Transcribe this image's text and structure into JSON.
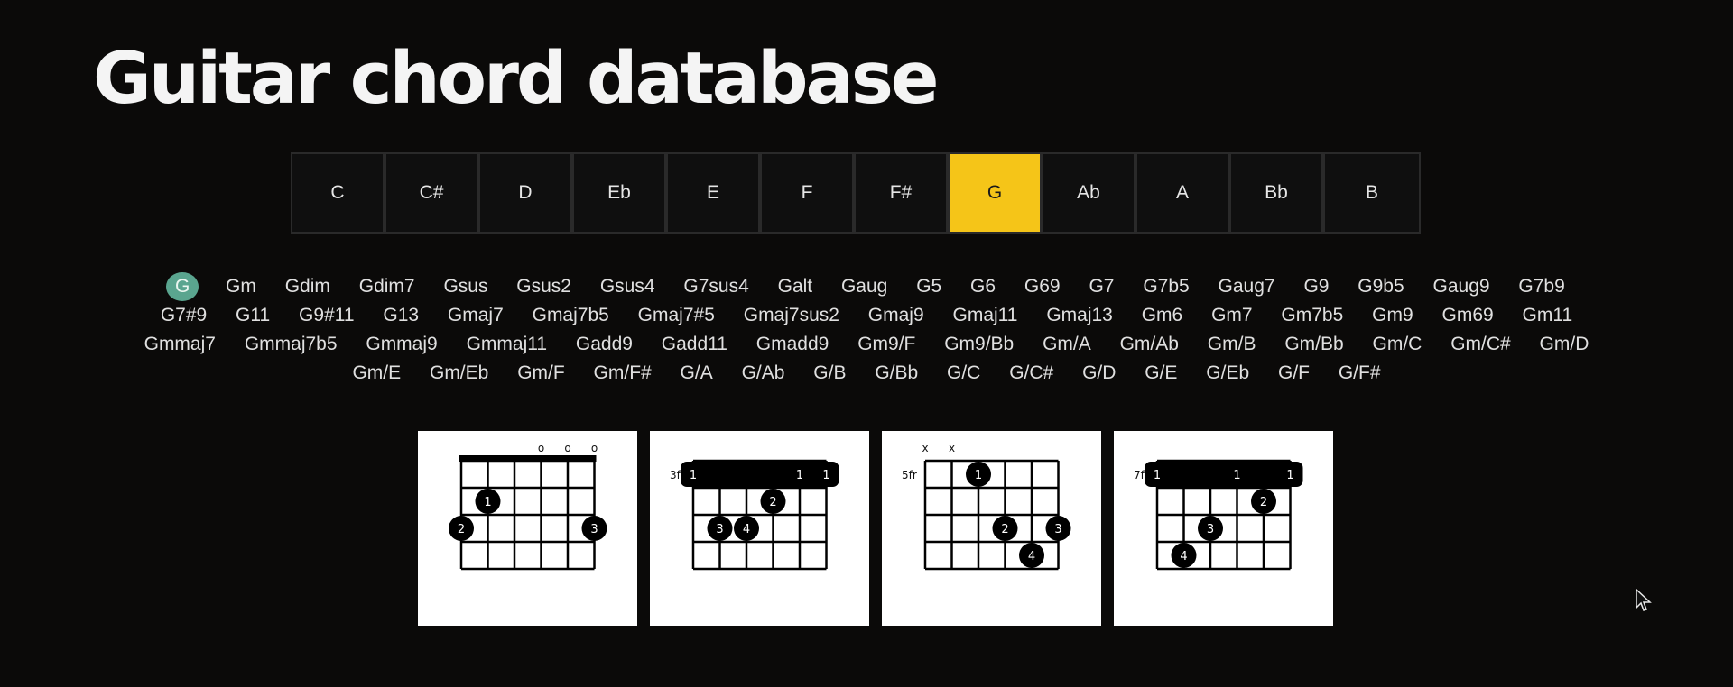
{
  "title": "Guitar chord database",
  "keys": [
    "C",
    "C#",
    "D",
    "Eb",
    "E",
    "F",
    "F#",
    "G",
    "Ab",
    "A",
    "Bb",
    "B"
  ],
  "active_key": "G",
  "chords": [
    "G",
    "Gm",
    "Gdim",
    "Gdim7",
    "Gsus",
    "Gsus2",
    "Gsus4",
    "G7sus4",
    "Galt",
    "Gaug",
    "G5",
    "G6",
    "G69",
    "G7",
    "G7b5",
    "Gaug7",
    "G9",
    "G9b5",
    "Gaug9",
    "G7b9",
    "G7#9",
    "G11",
    "G9#11",
    "G13",
    "Gmaj7",
    "Gmaj7b5",
    "Gmaj7#5",
    "Gmaj7sus2",
    "Gmaj9",
    "Gmaj11",
    "Gmaj13",
    "Gm6",
    "Gm7",
    "Gm7b5",
    "Gm9",
    "Gm69",
    "Gm11",
    "Gmmaj7",
    "Gmmaj7b5",
    "Gmmaj9",
    "Gmmaj11",
    "Gadd9",
    "Gadd11",
    "Gmadd9",
    "Gm9/F",
    "Gm9/Bb",
    "Gm/A",
    "Gm/Ab",
    "Gm/B",
    "Gm/Bb",
    "Gm/C",
    "Gm/C#",
    "Gm/D",
    "Gm/E",
    "Gm/Eb",
    "Gm/F",
    "Gm/F#",
    "G/A",
    "G/Ab",
    "G/B",
    "G/Bb",
    "G/C",
    "G/C#",
    "G/D",
    "G/E",
    "G/Eb",
    "G/F",
    "G/F#"
  ],
  "selected_chord": "G",
  "diagrams": [
    {
      "fret_label": "",
      "nut": true,
      "top_markers": [
        "",
        "",
        "",
        "o",
        "o",
        "o"
      ],
      "barre": null,
      "dots": [
        {
          "string": 2,
          "fret": 2,
          "finger": "1"
        },
        {
          "string": 1,
          "fret": 3,
          "finger": "2"
        },
        {
          "string": 6,
          "fret": 3,
          "finger": "3"
        }
      ]
    },
    {
      "fret_label": "3fr",
      "nut": false,
      "top_markers": [
        "",
        "",
        "",
        "",
        "",
        ""
      ],
      "barre": {
        "from": 1,
        "to": 6,
        "fret": 1,
        "labels": [
          {
            "string": 1,
            "finger": "1"
          },
          {
            "string": 5,
            "finger": "1"
          },
          {
            "string": 6,
            "finger": "1"
          }
        ]
      },
      "dots": [
        {
          "string": 4,
          "fret": 2,
          "finger": "2"
        },
        {
          "string": 2,
          "fret": 3,
          "finger": "3"
        },
        {
          "string": 3,
          "fret": 3,
          "finger": "4"
        }
      ]
    },
    {
      "fret_label": "5fr",
      "nut": false,
      "top_markers": [
        "x",
        "x",
        "",
        "",
        "",
        ""
      ],
      "barre": null,
      "dots": [
        {
          "string": 3,
          "fret": 1,
          "finger": "1"
        },
        {
          "string": 4,
          "fret": 3,
          "finger": "2"
        },
        {
          "string": 6,
          "fret": 3,
          "finger": "3"
        },
        {
          "string": 5,
          "fret": 4,
          "finger": "4"
        }
      ]
    },
    {
      "fret_label": "7fr",
      "nut": false,
      "top_markers": [
        "",
        "",
        "",
        "",
        "",
        ""
      ],
      "barre": {
        "from": 1,
        "to": 6,
        "fret": 1,
        "labels": [
          {
            "string": 1,
            "finger": "1"
          },
          {
            "string": 4,
            "finger": "1"
          },
          {
            "string": 6,
            "finger": "1"
          }
        ]
      },
      "dots": [
        {
          "string": 5,
          "fret": 2,
          "finger": "2"
        },
        {
          "string": 3,
          "fret": 3,
          "finger": "3"
        },
        {
          "string": 2,
          "fret": 4,
          "finger": "4"
        }
      ]
    }
  ],
  "colors": {
    "accent_key": "#f5c518",
    "selected_chord": "#5aa58f",
    "background": "#0b0a09"
  },
  "icons": {
    "cursor": "mouse-pointer-icon"
  }
}
